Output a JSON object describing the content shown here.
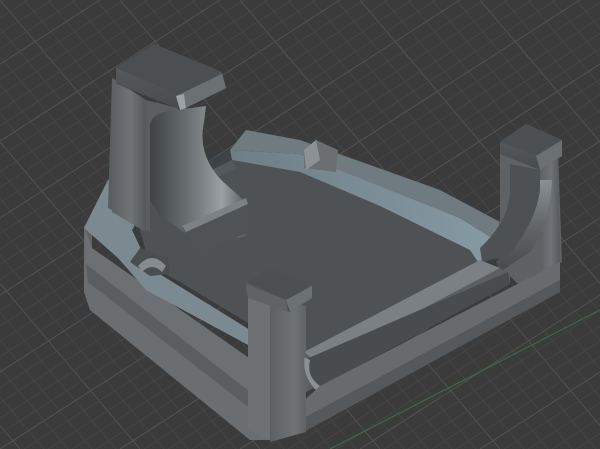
{
  "app": {
    "view": "3D viewport",
    "background_color": "#3b3b3b",
    "grid": {
      "visible": true,
      "minor_color": "#474747",
      "major_color": "#525252",
      "axis_color": "#3f6f44"
    },
    "model": {
      "icon": "3d-bracket-tray-icon",
      "body_color": "#676b6e",
      "top_face_color": "#53575a",
      "inner_wall_color": "#7b8b92",
      "floor_color": "#4d5154",
      "edge_color": "#2e3133"
    }
  }
}
